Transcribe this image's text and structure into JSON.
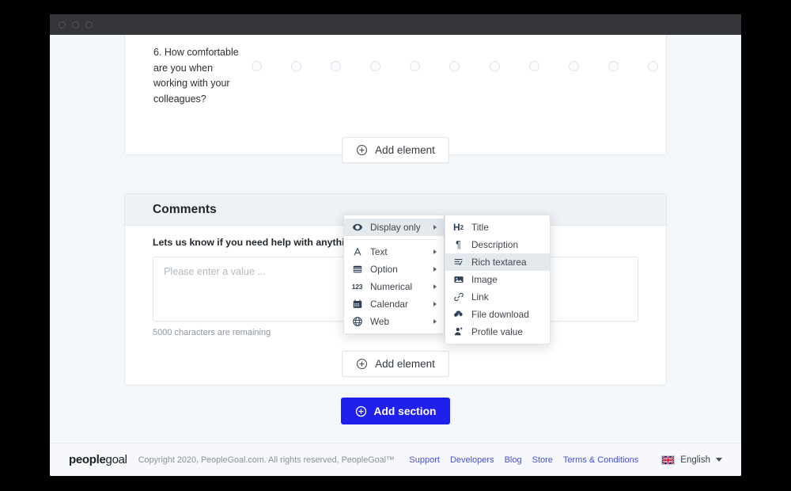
{
  "colors": {
    "accent": "#2020ec",
    "page_bg": "#f4f7fa",
    "titlebar": "#333538",
    "section_header_bg": "#eef1f5",
    "menu_highlight": "#e4e9ee",
    "link": "#4a50c8"
  },
  "question": {
    "text": "6. How comfortable are you when working with your colleagues?",
    "scale_points": 11
  },
  "buttons": {
    "add_element": "Add element",
    "add_element_2": "Add element",
    "add_section": "Add section"
  },
  "comments_section": {
    "title": "Comments",
    "description": "Lets us know if you need help with anything! We are",
    "textarea_placeholder": "Please enter a value ...",
    "textarea_value": "",
    "char_count": "5000 characters are remaining"
  },
  "menu_primary": {
    "items": [
      {
        "label": "Display only",
        "icon": "eye-icon",
        "has_submenu": true,
        "active": true
      },
      {
        "label": "Text",
        "icon": "letter-a-icon",
        "has_submenu": true,
        "active": false
      },
      {
        "label": "Option",
        "icon": "list-icon",
        "has_submenu": true,
        "active": false
      },
      {
        "label": "Numerical",
        "icon": "numbers-123-icon",
        "has_submenu": true,
        "active": false
      },
      {
        "label": "Calendar",
        "icon": "calendar-icon",
        "has_submenu": true,
        "active": false
      },
      {
        "label": "Web",
        "icon": "globe-icon",
        "has_submenu": true,
        "active": false
      }
    ]
  },
  "menu_submenu": {
    "items": [
      {
        "label": "Title",
        "icon": "heading-h2-icon",
        "active": false
      },
      {
        "label": "Description",
        "icon": "pilcrow-icon",
        "active": false
      },
      {
        "label": "Rich textarea",
        "icon": "rich-text-icon",
        "active": true
      },
      {
        "label": "Image",
        "icon": "image-icon",
        "active": false
      },
      {
        "label": "Link",
        "icon": "link-icon",
        "active": false
      },
      {
        "label": "File download",
        "icon": "cloud-download-icon",
        "active": false
      },
      {
        "label": "Profile value",
        "icon": "profile-person-icon",
        "active": false
      }
    ]
  },
  "footer": {
    "logo_bold": "people",
    "logo_light": "goal",
    "copyright": "Copyright 2020, PeopleGoal.com. All rights reserved, PeopleGoal™",
    "links": [
      "Support",
      "Developers",
      "Blog",
      "Store",
      "Terms & Conditions"
    ],
    "language": "English"
  }
}
